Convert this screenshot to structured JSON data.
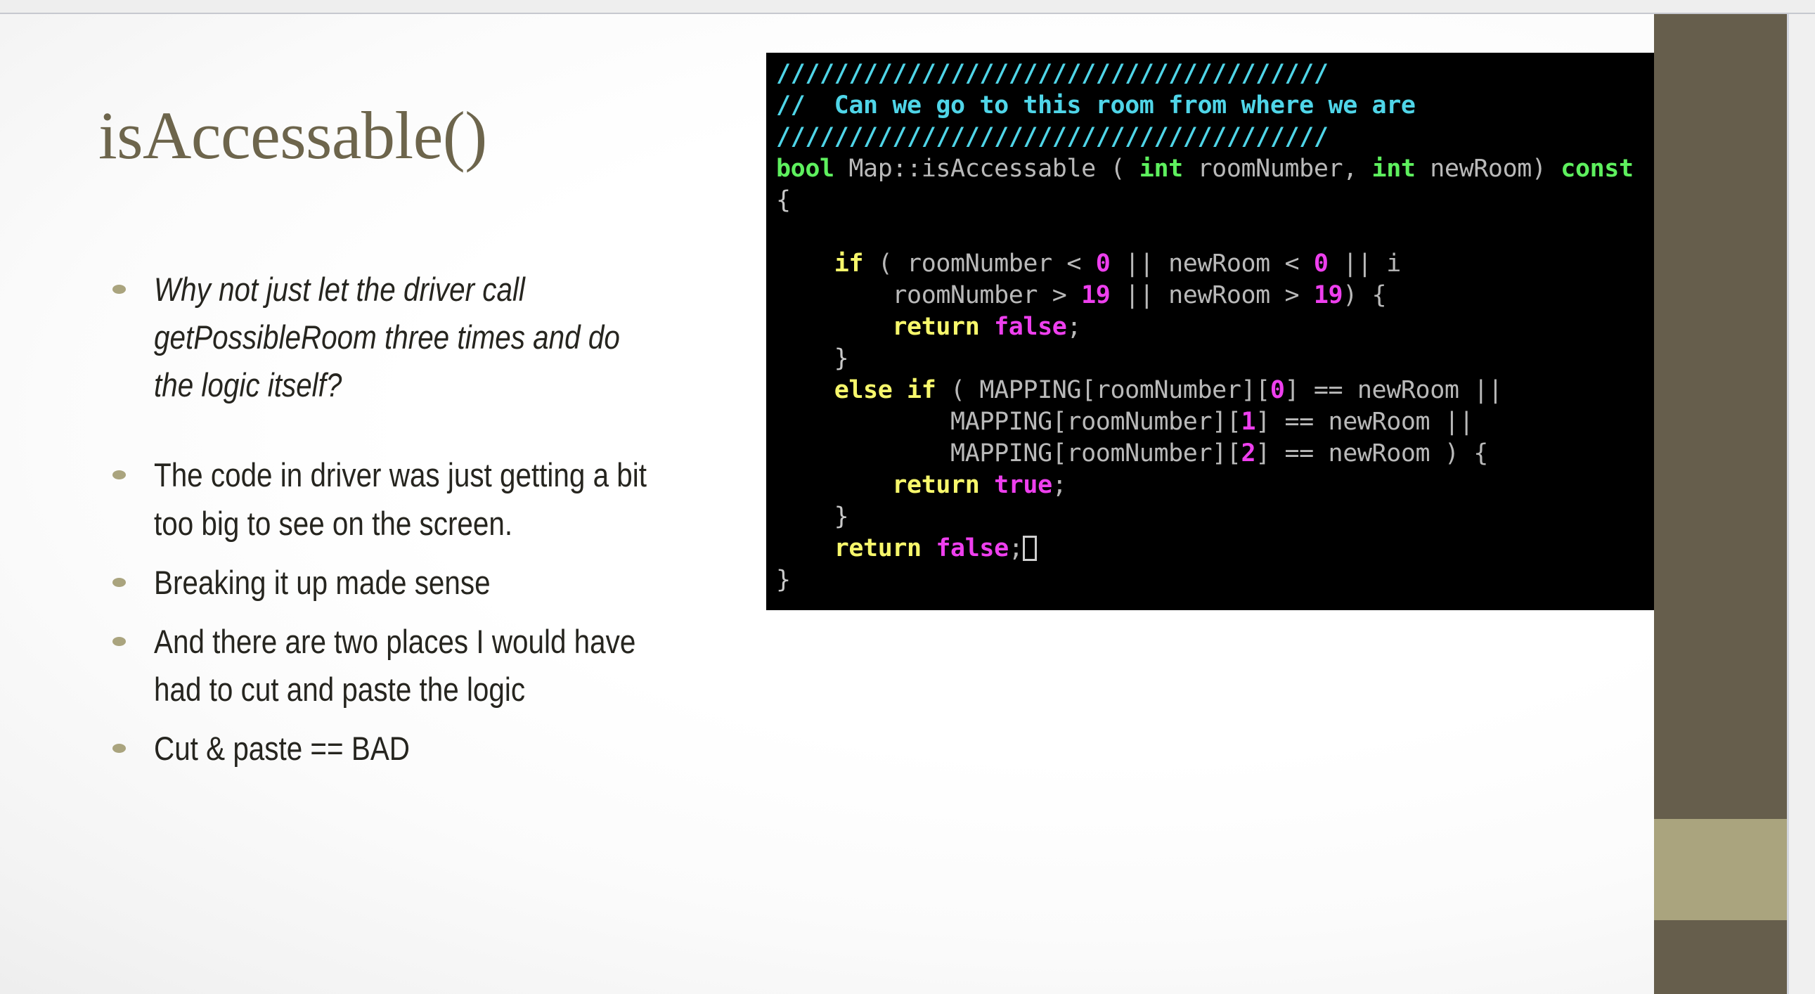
{
  "slide": {
    "title": "isAccessable()",
    "bullets": [
      {
        "text": "Why not just let the driver call getPossibleRoom three times and do the logic itself?",
        "italic": true,
        "gap_after": true
      },
      {
        "text": "The code in driver was just getting a bit too big to see on the screen.",
        "italic": false,
        "gap_after": false
      },
      {
        "text": "Breaking it up made sense",
        "italic": false,
        "gap_after": false
      },
      {
        "text": "And there are two places I would have had to cut and paste the logic",
        "italic": false,
        "gap_after": false
      },
      {
        "text": "Cut & paste == BAD",
        "italic": false,
        "gap_after": false
      }
    ]
  },
  "code_shot": {
    "language": "C++",
    "cursor_glyph": "block-cursor",
    "lines": [
      [
        {
          "t": "//////////////////////////////////////",
          "c": "comment"
        }
      ],
      [
        {
          "t": "//  Can we go to this room from where we are",
          "c": "comment"
        }
      ],
      [
        {
          "t": "//////////////////////////////////////",
          "c": "comment"
        }
      ],
      [
        {
          "t": "bool",
          "c": "type"
        },
        {
          "t": " Map::isAccessable ( ",
          "c": "plain"
        },
        {
          "t": "int",
          "c": "type"
        },
        {
          "t": " roomNumber, ",
          "c": "plain"
        },
        {
          "t": "int",
          "c": "type"
        },
        {
          "t": " newRoom) ",
          "c": "plain"
        },
        {
          "t": "const",
          "c": "type"
        }
      ],
      [
        {
          "t": "{",
          "c": "punct"
        }
      ],
      [
        {
          "t": "",
          "c": "plain"
        }
      ],
      [
        {
          "t": "    ",
          "c": "plain"
        },
        {
          "t": "if",
          "c": "kw"
        },
        {
          "t": " ( roomNumber < ",
          "c": "plain"
        },
        {
          "t": "0",
          "c": "lit"
        },
        {
          "t": " || newRoom < ",
          "c": "plain"
        },
        {
          "t": "0",
          "c": "lit"
        },
        {
          "t": " || i",
          "c": "plain"
        }
      ],
      [
        {
          "t": "        roomNumber > ",
          "c": "plain"
        },
        {
          "t": "19",
          "c": "lit"
        },
        {
          "t": " || newRoom > ",
          "c": "plain"
        },
        {
          "t": "19",
          "c": "lit"
        },
        {
          "t": ") {",
          "c": "plain"
        }
      ],
      [
        {
          "t": "        ",
          "c": "plain"
        },
        {
          "t": "return",
          "c": "kw"
        },
        {
          "t": " ",
          "c": "plain"
        },
        {
          "t": "false",
          "c": "lit"
        },
        {
          "t": ";",
          "c": "plain"
        }
      ],
      [
        {
          "t": "    }",
          "c": "punct"
        }
      ],
      [
        {
          "t": "    ",
          "c": "plain"
        },
        {
          "t": "else if",
          "c": "kw"
        },
        {
          "t": " ( MAPPING[roomNumber][",
          "c": "plain"
        },
        {
          "t": "0",
          "c": "lit"
        },
        {
          "t": "] == newRoom ||",
          "c": "plain"
        }
      ],
      [
        {
          "t": "            MAPPING[roomNumber][",
          "c": "plain"
        },
        {
          "t": "1",
          "c": "lit"
        },
        {
          "t": "] == newRoom ||",
          "c": "plain"
        }
      ],
      [
        {
          "t": "            MAPPING[roomNumber][",
          "c": "plain"
        },
        {
          "t": "2",
          "c": "lit"
        },
        {
          "t": "] == newRoom ) {",
          "c": "plain"
        }
      ],
      [
        {
          "t": "        ",
          "c": "plain"
        },
        {
          "t": "return",
          "c": "kw"
        },
        {
          "t": " ",
          "c": "plain"
        },
        {
          "t": "true",
          "c": "lit"
        },
        {
          "t": ";",
          "c": "plain"
        }
      ],
      [
        {
          "t": "    }",
          "c": "punct"
        }
      ],
      [
        {
          "t": "    ",
          "c": "plain"
        },
        {
          "t": "return",
          "c": "kw"
        },
        {
          "t": " ",
          "c": "plain"
        },
        {
          "t": "false",
          "c": "lit"
        },
        {
          "t": ";",
          "c": "plain"
        },
        {
          "t": "█",
          "c": "cursor"
        }
      ],
      [
        {
          "t": "}",
          "c": "punct"
        }
      ]
    ]
  },
  "theme": {
    "title_color": "#6d654c",
    "bullet_dot_color": "#aaa47e",
    "body_text_color": "#26251f",
    "deco_bar_color": "#665e4c",
    "deco_band_color": "#aaa47e",
    "code_bg": "#000000",
    "code_comment": "#4fd5e8",
    "code_type": "#5ef05e",
    "code_keyword": "#f7f76b",
    "code_literal": "#ee3fee",
    "code_plain": "#b9b9b9"
  }
}
